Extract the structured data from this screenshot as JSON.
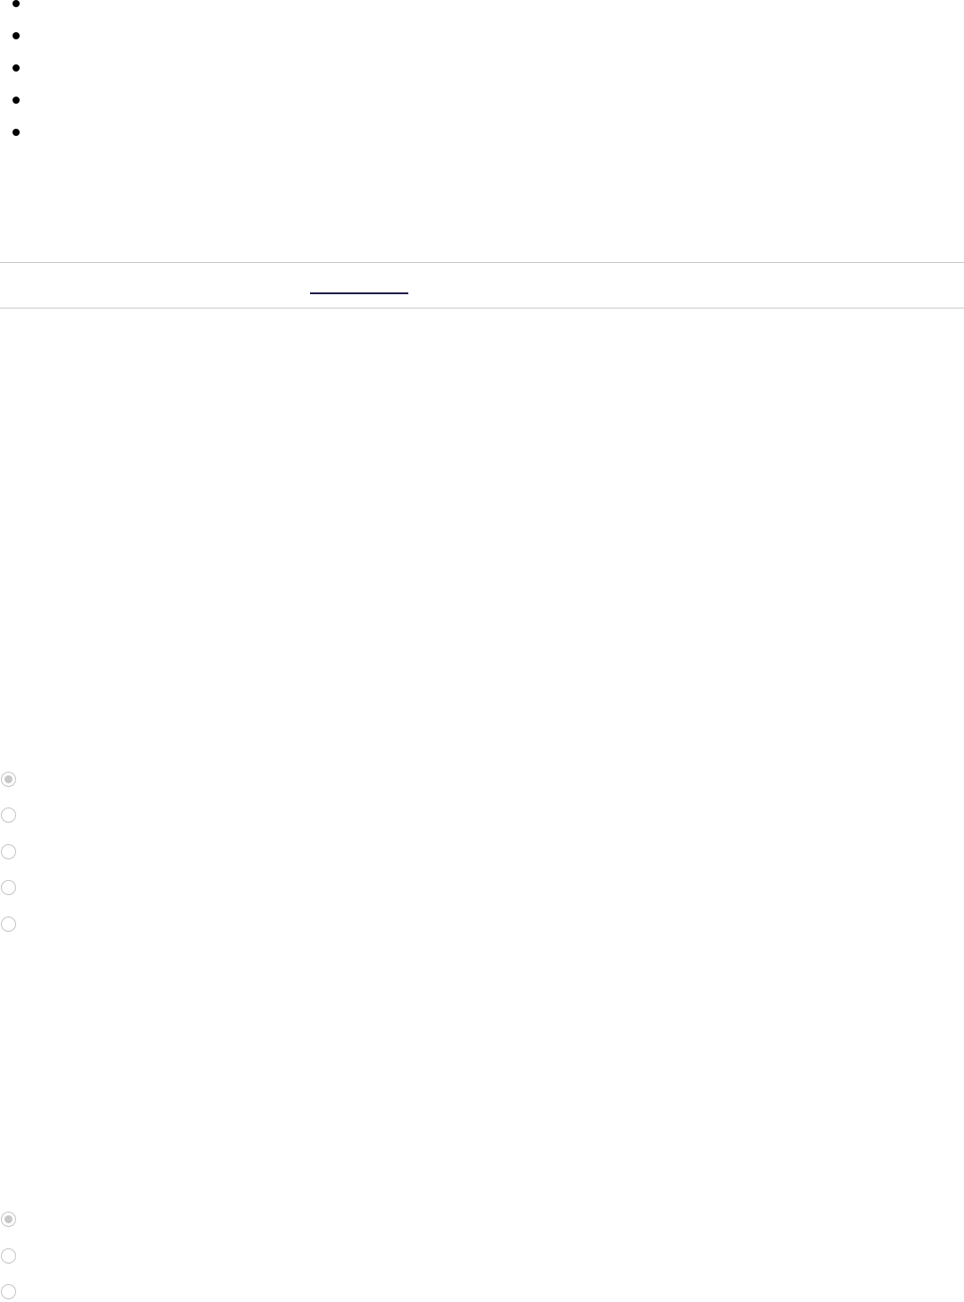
{
  "bullet_list": {
    "items": [
      {
        "label": ""
      },
      {
        "label": ""
      },
      {
        "label": ""
      },
      {
        "label": ""
      },
      {
        "label": ""
      }
    ]
  },
  "tab_bar": {
    "active_tab_label": ""
  },
  "radio_group_1": {
    "options": [
      {
        "label": "",
        "checked": true
      },
      {
        "label": "",
        "checked": false
      },
      {
        "label": "",
        "checked": false
      },
      {
        "label": "",
        "checked": false
      },
      {
        "label": "",
        "checked": false
      }
    ]
  },
  "radio_group_2": {
    "options": [
      {
        "label": "",
        "checked": true
      },
      {
        "label": "",
        "checked": false
      },
      {
        "label": "",
        "checked": false
      }
    ]
  },
  "colors": {
    "divider": "#c8c8c8",
    "tab_underline": "#1c1c4a",
    "radio_border": "#c4c4c4",
    "radio_checked_dot": "#c8c8c8"
  }
}
